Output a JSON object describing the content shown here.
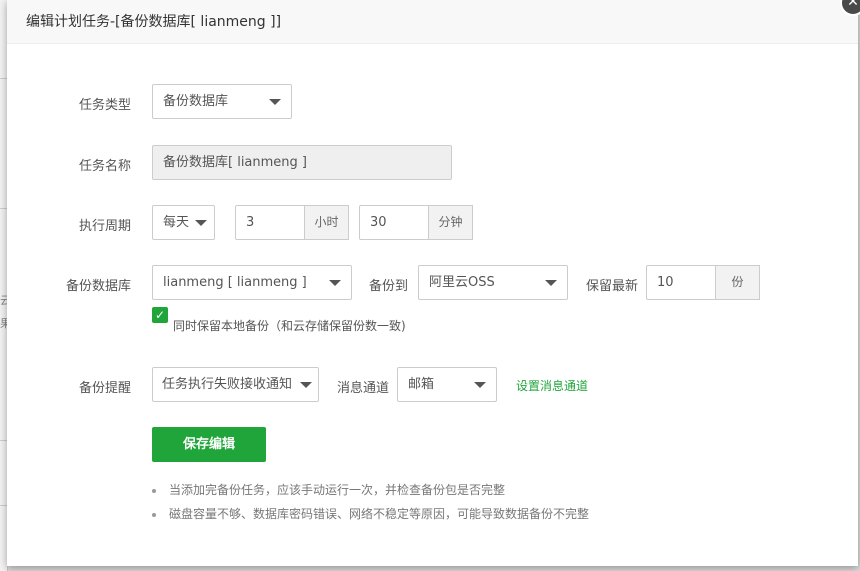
{
  "dialog": {
    "title": "编辑计划任务-[备份数据库[ lianmeng ]]"
  },
  "form": {
    "task_type": {
      "label": "任务类型",
      "value": "备份数据库"
    },
    "task_name": {
      "label": "任务名称",
      "value": "备份数据库[ lianmeng ]"
    },
    "period": {
      "label": "执行周期",
      "freq": "每天",
      "hour": "3",
      "hour_unit": "小时",
      "minute": "30",
      "minute_unit": "分钟"
    },
    "backup_db": {
      "label": "备份数据库",
      "value": "lianmeng [ lianmeng ]",
      "backup_to_label": "备份到",
      "backup_to_value": "阿里云OSS",
      "keep_label": "保留最新",
      "keep_value": "10",
      "keep_unit": "份",
      "keep_local_label": "同时保留本地备份（和云存储保留份数一致)",
      "keep_local_checked": true
    },
    "notify": {
      "label": "备份提醒",
      "value": "任务执行失败接收通知",
      "channel_label": "消息通道",
      "channel_value": "邮箱",
      "setup_link": "设置消息通道"
    },
    "save_label": "保存编辑"
  },
  "tips": [
    "当添加完备份任务，应该手动运行一次，并检查备份包是否完整",
    "磁盘容量不够、数据库密码错误、网络不稳定等原因，可能导致数据备份不完整"
  ],
  "background": {
    "char1": "云",
    "char2": "果"
  },
  "colors": {
    "accent": "#20a53a",
    "close_bg": "#4a4a4a"
  },
  "icons": {
    "close": "close-icon",
    "caret": "caret-down-icon",
    "check": "check-icon"
  }
}
